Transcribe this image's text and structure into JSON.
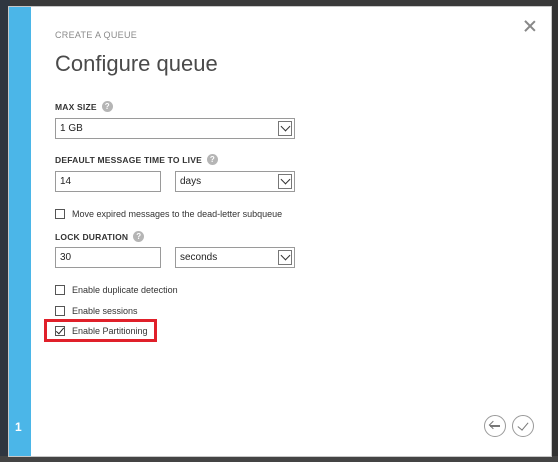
{
  "dialog": {
    "kicker": "CREATE A QUEUE",
    "title": "Configure queue",
    "step": "1",
    "accent_color": "#4bb6e8"
  },
  "fields": {
    "max_size": {
      "label": "MAX SIZE",
      "value": "1 GB"
    },
    "ttl": {
      "label": "DEFAULT MESSAGE TIME TO LIVE",
      "value": "14",
      "unit": "days"
    },
    "dead_letter": {
      "label": "Move expired messages to the dead-letter subqueue",
      "checked": false
    },
    "lock": {
      "label": "LOCK DURATION",
      "value": "30",
      "unit": "seconds"
    },
    "duplicate": {
      "label": "Enable duplicate detection",
      "checked": false
    },
    "sessions": {
      "label": "Enable sessions",
      "checked": false
    },
    "partitioning": {
      "label": "Enable Partitioning",
      "checked": true
    }
  },
  "icons": {
    "help": "?",
    "close": "close-icon",
    "back": "back-arrow-icon",
    "confirm": "checkmark-icon"
  },
  "highlight_color": "#e0202a"
}
